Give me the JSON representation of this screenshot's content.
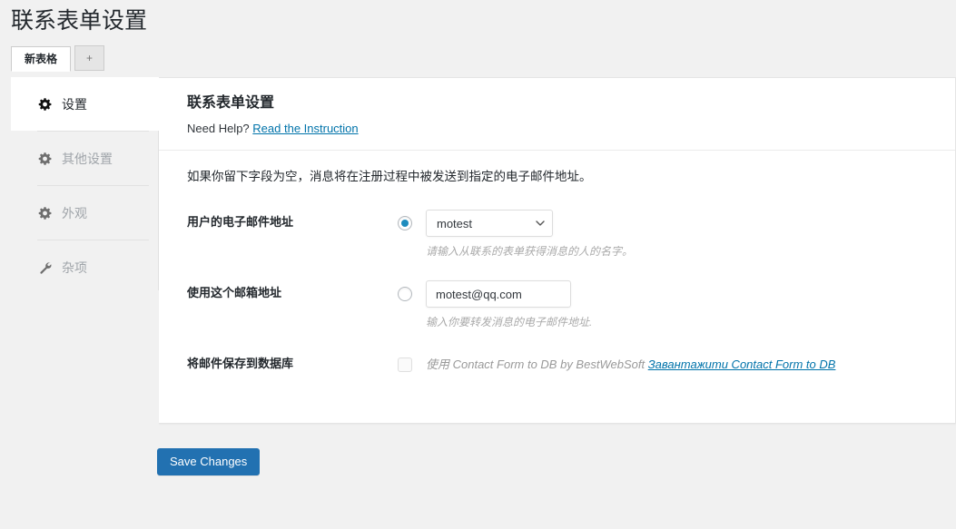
{
  "page": {
    "title": "联系表单设置"
  },
  "tabs": [
    {
      "label": "新表格",
      "active": true
    },
    {
      "label": "+",
      "active": false
    }
  ],
  "sidebar": {
    "items": [
      {
        "label": "设置",
        "icon": "gear-icon",
        "active": true
      },
      {
        "label": "其他设置",
        "icon": "gear-icon",
        "active": false
      },
      {
        "label": "外观",
        "icon": "gear-icon",
        "active": false
      },
      {
        "label": "杂项",
        "icon": "wrench-icon",
        "active": false
      }
    ]
  },
  "content": {
    "title": "联系表单设置",
    "need_help_text": "Need Help?",
    "need_help_link": "Read the Instruction",
    "intro": "如果你留下字段为空，消息将在注册过程中被发送到指定的电子邮件地址。",
    "rows": {
      "user_email": {
        "label": "用户的电子邮件地址",
        "radio_checked": true,
        "select_value": "motest",
        "hint": "请输入从联系的表单获得消息的人的名字。"
      },
      "custom_email": {
        "label": "使用这个邮箱地址",
        "radio_checked": false,
        "input_value": "motest@qq.com",
        "input_placeholder": "motest@qq.com",
        "hint": "输入你要转发消息的电子邮件地址."
      },
      "save_to_db": {
        "label": "将邮件保存到数据库",
        "checkbox_checked": false,
        "text": "使用 Contact Form to DB by BestWebSoft",
        "link": "Завантажити Contact Form to DB"
      }
    }
  },
  "footer": {
    "save_label": "Save Changes"
  },
  "colors": {
    "accent": "#2271b1",
    "link": "#0073aa",
    "radio_dot": "#1e8cbe",
    "page_bg": "#f1f1f1",
    "panel_bg": "#ffffff"
  }
}
